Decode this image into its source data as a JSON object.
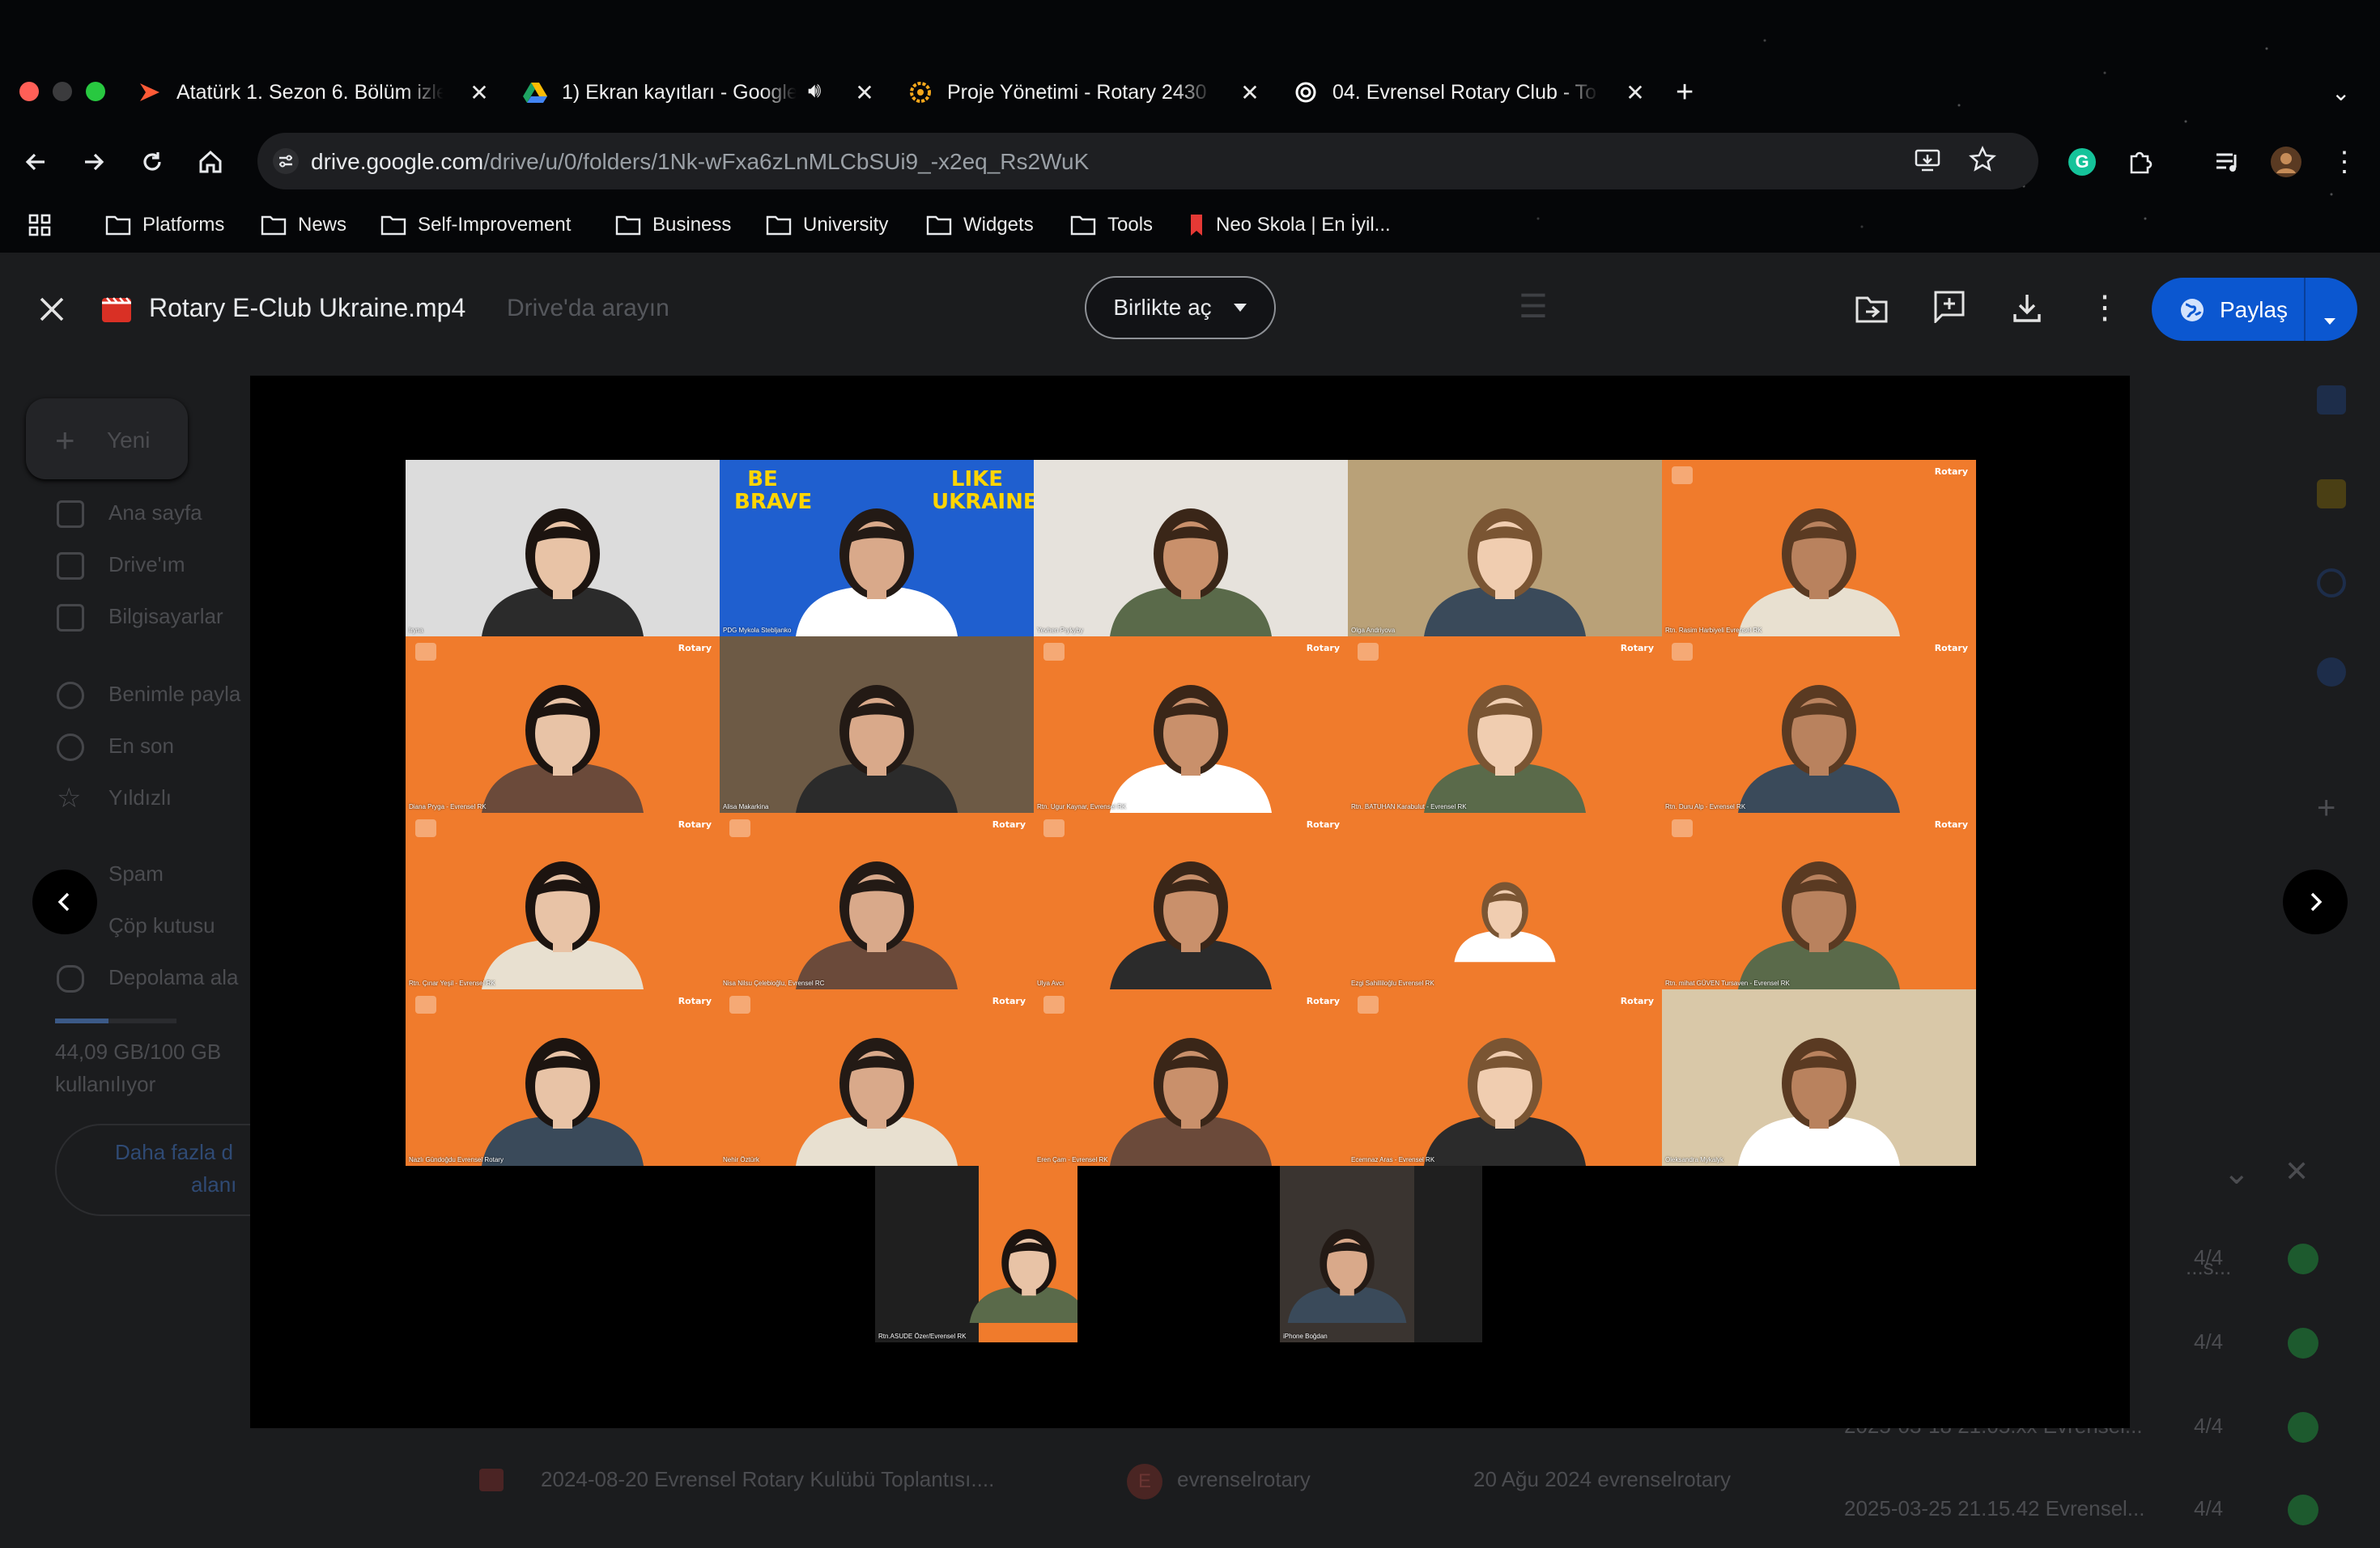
{
  "browser": {
    "tabs": [
      {
        "title": "Atatürk 1. Sezon 6. Bölüm izle",
        "icon": "play-logo-icon",
        "muted": false
      },
      {
        "title": "1) Ekran kayıtları - Google",
        "icon": "google-drive-icon",
        "audio": true
      },
      {
        "title": "Proje Yönetimi - Rotary 2430",
        "icon": "rotary-wheel-icon"
      },
      {
        "title": "04. Evrensel Rotary Club - To",
        "icon": "chatgpt-icon"
      }
    ],
    "new_tab": "+",
    "url_host": "drive.google.com",
    "url_path": "/drive/u/0/folders/1Nk-wFxa6zLnMLCbSUi9_-x2eq_Rs2WuK",
    "bookmarks": [
      "Platforms",
      "News",
      "Self-Improvement",
      "Business",
      "University",
      "Widgets",
      "Tools",
      "Neo Skola | En İyil..."
    ]
  },
  "viewer": {
    "file_name": "Rotary E-Club Ukraine.mp4",
    "search_placeholder": "Drive'da arayın",
    "open_with": "Birlikte aç",
    "share": "Paylaş"
  },
  "drive_bg": {
    "new_button": "Yeni",
    "nav": [
      "Ana sayfa",
      "Drive'ım",
      "Bilgisayarlar",
      "Benimle payla",
      "En son",
      "Yıldızlı",
      "Spam",
      "Çöp kutusu",
      "Depolama ala"
    ],
    "storage_text": "44,09 GB/100 GB",
    "storage_sub": "kullanılıyor",
    "storage_fraction": 0.44,
    "more_space_1": "Daha fazla d",
    "more_space_2": "alanı",
    "file_row": "2024-08-20 Evrensel Rotary Kulübü Toplantısı....",
    "owner": "evrenselrotary",
    "owner_initial": "E",
    "date": "20 Ağu 2024 evrenselrotary",
    "uploads": [
      {
        "name": "...s...",
        "count": "4/4"
      },
      {
        "name": "...el...",
        "count": "4/4"
      },
      {
        "name": "2025-03-18 21.05.xx Evrensel...",
        "count": "4/4"
      },
      {
        "name": "2025-03-25 21.15.42 Evrensel...",
        "count": "4/4"
      }
    ]
  },
  "participants": [
    {
      "name": "Iryna",
      "bg": "#dcdcdc"
    },
    {
      "name": "PDG Mykola Stebljanko",
      "bg": "#1f5fcf"
    },
    {
      "name": "Yevhen Prykyby",
      "bg": "#e6e2dc"
    },
    {
      "name": "Olga Andriyova",
      "bg": "#b9a178"
    },
    {
      "name": "Rtn. Rasim Harbiyeli Evrensel RK",
      "bg": "#f07b2c"
    },
    {
      "name": "Diana Pryga - Evrensel RK",
      "bg": "#f07b2c"
    },
    {
      "name": "Alisa Makarkina",
      "bg": "#6d5a45"
    },
    {
      "name": "Rtn. Ugur Kaynar, Evrensel RK",
      "bg": "#f07b2c"
    },
    {
      "name": "Rtn. BATUHAN Karabulut - Evrensel RK",
      "bg": "#f07b2c"
    },
    {
      "name": "Rtn. Duru Alp - Evrensel RK",
      "bg": "#f07b2c"
    },
    {
      "name": "Rtn. Çınar Yeşil - Evrensel RK",
      "bg": "#f07b2c"
    },
    {
      "name": "Nisa Nilsu Çelebioğlu, Evrensel RC",
      "bg": "#f07b2c"
    },
    {
      "name": "Ulya Avcı",
      "bg": "#f07b2c"
    },
    {
      "name": "Ezgi Sahilliloğlu Evrensel RK",
      "bg": "#f07b2c"
    },
    {
      "name": "Rtn. mihat GÜVEN Tursaven - Evrensel RK",
      "bg": "#f07b2c"
    },
    {
      "name": "Nazlı Gündoğdu Evrensel Rotary",
      "bg": "#f07b2c"
    },
    {
      "name": "Nehir Öztürk",
      "bg": "#f07b2c"
    },
    {
      "name": "Eren Çam - Evrensel RK",
      "bg": "#f07b2c"
    },
    {
      "name": "Ecemnaz Aras - Evrensel RK",
      "bg": "#f07b2c"
    },
    {
      "name": "Oleksandra Mykalyk",
      "bg": "#d9c8a8"
    },
    {
      "name": "Rtn.ASUDE Özer/Evrensel RK",
      "bg": "#f07b2c"
    },
    {
      "name": "iPhone Boğdan",
      "bg": "#3a3430"
    }
  ],
  "poster_left": "BE BRAVE",
  "poster_right": "LIKE UKRAINE",
  "rotary_logo": "Rotary",
  "colors": {
    "accent": "#0b57d0",
    "zoom_orange": "#f07b2c"
  }
}
